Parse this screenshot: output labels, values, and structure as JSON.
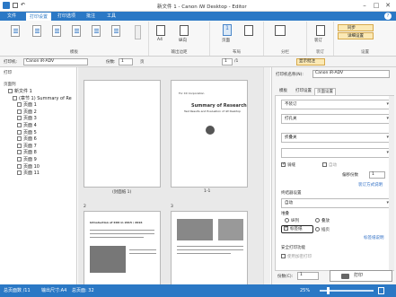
{
  "window": {
    "title": "新文件 1 - Canon iW Desktop - Editor",
    "min": "–",
    "max": "□",
    "close": "✕"
  },
  "menu": {
    "tabs": [
      "文件",
      "打印设置",
      "打印选项",
      "批注",
      "工具"
    ],
    "active": 1
  },
  "ribbon": {
    "group_labels": [
      "模板",
      "输出边距",
      "布局",
      "分栏",
      "装订",
      "设置"
    ],
    "paper_size": "A4",
    "orientation": "纵向",
    "copies_label": "1",
    "collate": "页面",
    "binding": "装订",
    "option_print": "仅模",
    "setting_options": [
      "同步",
      "详细设置"
    ],
    "icons": [
      "print-preview-icon",
      "double-side-icon"
    ]
  },
  "toolbar": {
    "printer_label": "打印机:",
    "printer": "Canon iR-ADV",
    "copies_label": "份数:",
    "copies": "1",
    "pages_label": "页",
    "page_index": "1",
    "page_total": "/1",
    "display_btn": "显示批注"
  },
  "tree": {
    "header": "打印",
    "root_label": "页面列",
    "items": [
      {
        "label": "新文件 1",
        "indent": 1
      },
      {
        "label": "(章节 1) Summary of Re",
        "indent": 2
      },
      {
        "label": "页面 1",
        "indent": 3
      },
      {
        "label": "页面 2",
        "indent": 3
      },
      {
        "label": "页面 3",
        "indent": 3
      },
      {
        "label": "页面 4",
        "indent": 3
      },
      {
        "label": "页面 5",
        "indent": 3
      },
      {
        "label": "页面 6",
        "indent": 3
      },
      {
        "label": "页面 7",
        "indent": 3
      },
      {
        "label": "页面 8",
        "indent": 3
      },
      {
        "label": "页面 9",
        "indent": 3
      },
      {
        "label": "页面 10",
        "indent": 3
      },
      {
        "label": "页面 11",
        "indent": 3
      }
    ]
  },
  "center": {
    "pages": [
      {
        "caption": "(封面纸 1)",
        "number": ""
      },
      {
        "caption": "1-1",
        "number": ""
      },
      {
        "caption": "",
        "number": "2"
      },
      {
        "caption": "",
        "number": "3"
      }
    ],
    "page_text": {
      "company": "For XX Corporation",
      "title": "Summary of Research",
      "subtitle": "Test Results and Evaluation of iW Desktop",
      "section": "Introduction of XXX in 2015 / 2016"
    }
  },
  "right": {
    "printer_label": "打印机名称(N):",
    "printer": "Canon iR-ADV",
    "tabs": [
      "模板",
      "打印设置",
      "页面设置"
    ],
    "active_tab": 2,
    "select1": "不装订",
    "select2": "打孔关",
    "select3": "折叠关",
    "select4": "",
    "check1": "骑缝",
    "check2": "自动",
    "offset_label": "偏移份数",
    "offset_value": "1",
    "detail_link": "装订方式说明",
    "finish_label": "终结器设置",
    "finish_value": "自动",
    "stack_label": "堆叠",
    "radio1": "纵列",
    "radio2": "叠放",
    "tab_paper": "标签纸",
    "radio3": "插页",
    "tab_paper_link": "标签纸说明",
    "secure_label": "安全打印功能",
    "secure_check": "使用加密打印",
    "copies_label": "份数(C):",
    "copies": "1",
    "print_btn": "打印"
  },
  "status": {
    "pages": "总页面数 /11",
    "size": "输出尺寸:A4",
    "selected": "总页面: 32",
    "zoom": "25%"
  }
}
